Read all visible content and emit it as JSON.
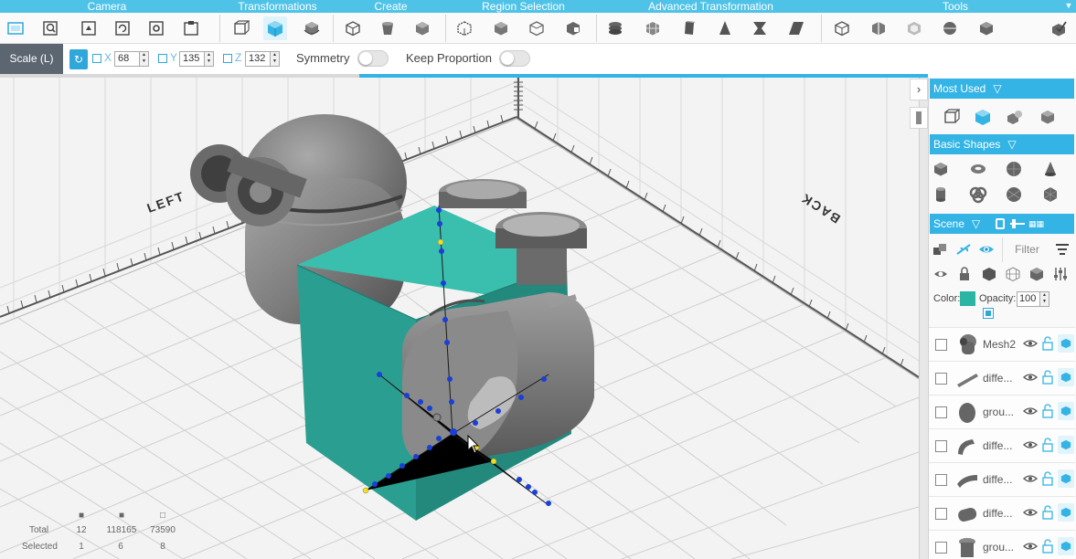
{
  "ribbon": {
    "headers": [
      "Camera",
      "Transformations",
      "Create",
      "Region Selection",
      "Advanced Transformation",
      "Tools"
    ],
    "tool_icons": {
      "camera": [
        "home-view-icon",
        "zoom-fit-icon",
        "snapshot-icon",
        "rotate-view-icon",
        "camera-settings-icon",
        "save-view-icon"
      ],
      "transformations": [
        "scale-icon",
        "move-icon",
        "rotate-icon"
      ],
      "create": [
        "add-shape-icon",
        "add-shape-alt-icon",
        "add-box-icon"
      ],
      "region_selection": [
        "select-region-icon",
        "select-brush-icon",
        "select-face-icon",
        "select-invert-icon"
      ],
      "advanced_transformation": [
        "stack-icon",
        "lattice-icon",
        "bend-icon",
        "taper-icon",
        "twist-icon",
        "shear-icon"
      ],
      "tools": [
        "measure-icon",
        "slice-icon",
        "hollow-icon",
        "split-icon",
        "solidify-icon",
        "repair-icon"
      ]
    }
  },
  "options": {
    "mode_label": "Scale (L)",
    "x_label": "X",
    "x_value": "68",
    "y_label": "Y",
    "y_value": "135",
    "z_label": "Z",
    "z_value": "132",
    "symmetry_label": "Symmetry",
    "keep_proportion_label": "Keep Proportion",
    "symmetry_on": false,
    "keep_proportion_on": false
  },
  "viewport": {
    "left_tag": "LEFT",
    "back_tag": "BACK",
    "stats": {
      "total_label": "Total",
      "selected_label": "Selected",
      "total_values": [
        "12",
        "118165",
        "73590"
      ],
      "selected_values": [
        "1",
        "6",
        "8"
      ]
    }
  },
  "panel": {
    "most_used_title": "Most Used",
    "basic_shapes_title": "Basic Shapes",
    "scene_title": "Scene",
    "filter_label": "Filter",
    "color_label": "Color:",
    "opacity_label": "Opacity:",
    "opacity_value": "100",
    "selected_color": "#2bb5a5",
    "objects": [
      {
        "name": "Mesh2"
      },
      {
        "name": "diffe..."
      },
      {
        "name": "grou..."
      },
      {
        "name": "diffe..."
      },
      {
        "name": "diffe..."
      },
      {
        "name": "diffe..."
      },
      {
        "name": "grou..."
      }
    ]
  },
  "colors": {
    "accent": "#33b4e5",
    "ribbon": "#4fc3e7",
    "mode_label_bg": "#5c6670",
    "selected_box": "#2bb5a5",
    "mesh_gray": "#8a8a8a"
  }
}
